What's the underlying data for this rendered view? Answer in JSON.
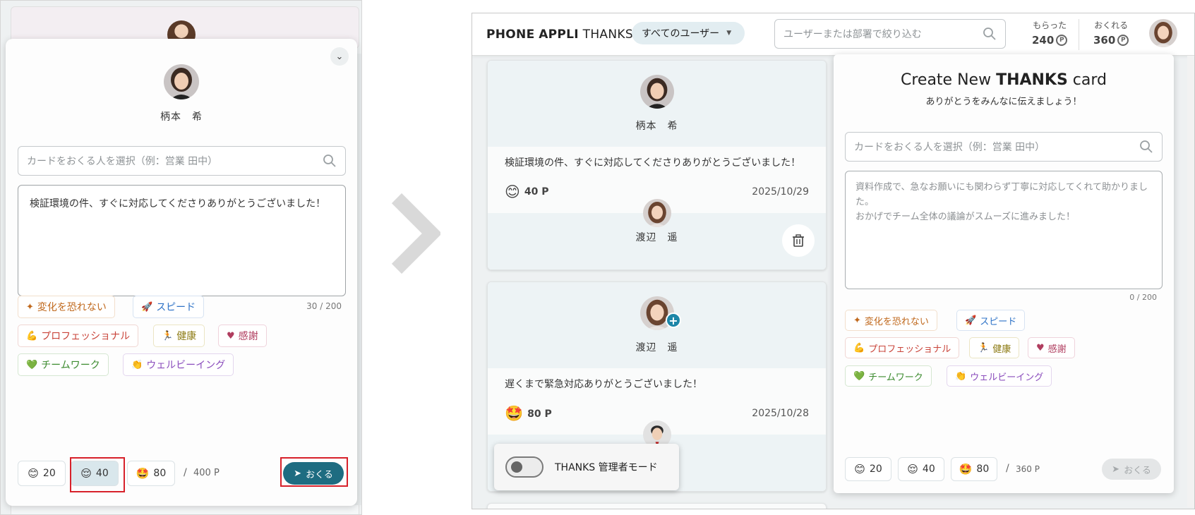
{
  "left": {
    "modal": {
      "sender_name": "柄本　希",
      "recipient_placeholder": "カードをおくる人を選択（例：営業 田中）",
      "message_text": "検証環境の件、すぐに対応してくださりありがとうございました！",
      "char_count": "30 / 200",
      "tags": [
        {
          "label": "変化を恐れない",
          "icon": "sparkle-icon"
        },
        {
          "label": "スピード",
          "icon": "rocket-icon"
        },
        {
          "label": "プロフェッショナル",
          "icon": "muscle-icon"
        },
        {
          "label": "健康",
          "icon": "runner-icon"
        },
        {
          "label": "感謝",
          "icon": "heart-icon"
        },
        {
          "label": "チームワーク",
          "icon": "heart-icon"
        },
        {
          "label": "ウェルビーイング",
          "icon": "hand-icon"
        }
      ],
      "points": [
        {
          "value": "20",
          "emoji": "😊",
          "selected": false
        },
        {
          "value": "40",
          "emoji": "😌",
          "selected": true
        },
        {
          "value": "80",
          "emoji": "🤩",
          "selected": false
        }
      ],
      "slash": "/",
      "total_points": "400 P",
      "send_label": "おくる"
    }
  },
  "right": {
    "header": {
      "brand_bold1": "PHONE",
      "brand_bold2": "APPLI",
      "brand_thin": "THANKS",
      "filter_label": "すべてのユーザー",
      "search_placeholder": "ユーザーまたは部署で絞り込む",
      "received_label": "もらった",
      "received_value": "240",
      "sendable_label": "おくれる",
      "sendable_value": "360",
      "coin_symbol": "P"
    },
    "cards": [
      {
        "sender": "柄本　希",
        "message": "検証環境の件、すぐに対応してくださりありがとうございました！",
        "points": "40 P",
        "emoji": "😊",
        "date": "2025/10/29",
        "receiver": "渡辺　遥"
      },
      {
        "sender": "渡辺　遥",
        "message": "遅くまで緊急対応ありがとうございました！",
        "points": "80 P",
        "emoji": "🤩",
        "date": "2025/10/28"
      }
    ],
    "create": {
      "title_prefix": "Create New ",
      "title_bold": "THANKS",
      "title_suffix": " card",
      "subtitle": "ありがとうをみんなに伝えましょう！",
      "recipient_placeholder": "カードをおくる人を選択（例：営業 田中）",
      "message_placeholder": "資料作成で、急なお願いにも関わらず丁寧に対応してくれて助かりました。\nおかげでチーム全体の議論がスムーズに進みました！",
      "char_count": "0 / 200",
      "tags": [
        {
          "label": "変化を恐れない",
          "icon": "sparkle-icon"
        },
        {
          "label": "スピード",
          "icon": "rocket-icon"
        },
        {
          "label": "プロフェッショナル",
          "icon": "muscle-icon"
        },
        {
          "label": "健康",
          "icon": "runner-icon"
        },
        {
          "label": "感謝",
          "icon": "heart-icon"
        },
        {
          "label": "チームワーク",
          "icon": "heart-icon"
        },
        {
          "label": "ウェルビーイング",
          "icon": "hand-icon"
        }
      ],
      "points": [
        {
          "value": "20",
          "emoji": "😊"
        },
        {
          "value": "40",
          "emoji": "😌"
        },
        {
          "value": "80",
          "emoji": "🤩"
        }
      ],
      "slash": "/",
      "total_points": "360 P",
      "send_label": "おくる"
    },
    "admin_mode_label": "THANKS 管理者モード"
  },
  "colors": {
    "accent": "#1e6c81",
    "highlight": "#d7212a",
    "selected_point": "#d9e7ec"
  }
}
